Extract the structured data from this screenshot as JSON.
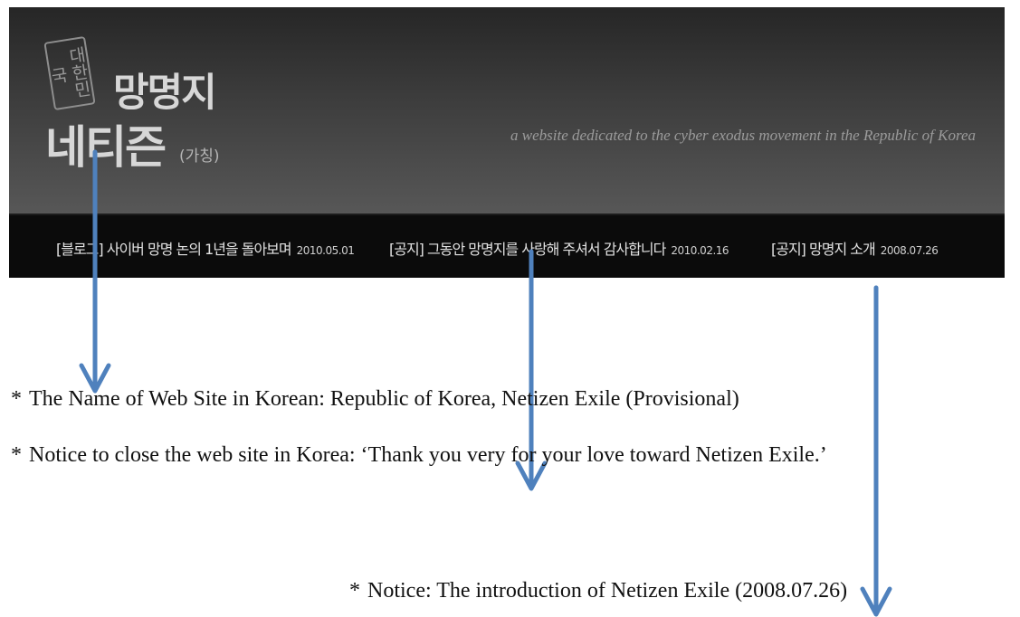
{
  "header": {
    "logo_vertical": "대한민국",
    "logo_top": "망명지",
    "logo_bottom": "네티즌",
    "logo_paren": "(가칭)",
    "tagline": "a website dedicated to the cyber exodus movement in the Republic of Korea"
  },
  "notices": [
    {
      "label": "[블로그] 사이버 망명 논의 1년을 돌아보며",
      "date": "2010.05.01"
    },
    {
      "label": "[공지] 그동안 망명지를 사랑해 주셔서 감사합니다",
      "date": "2010.02.16"
    },
    {
      "label": "[공지] 망명지 소개",
      "date": "2008.07.26"
    }
  ],
  "captions": [
    {
      "bullet": "*",
      "text": "The Name of Web Site in Korean: Republic of Korea, Netizen Exile (Provisional)"
    },
    {
      "bullet": "*",
      "text": "Notice to close the web site in Korea: ‘Thank you very for your love toward Netizen Exile.’"
    },
    {
      "bullet": "*",
      "text": "Notice: The introduction of Netizen Exile (2008.07.26)"
    }
  ],
  "colors": {
    "header_top": "#262626",
    "header_bottom": "#575757",
    "notice_bar": "#0b0b0b",
    "arrow": "#4f81bd"
  }
}
